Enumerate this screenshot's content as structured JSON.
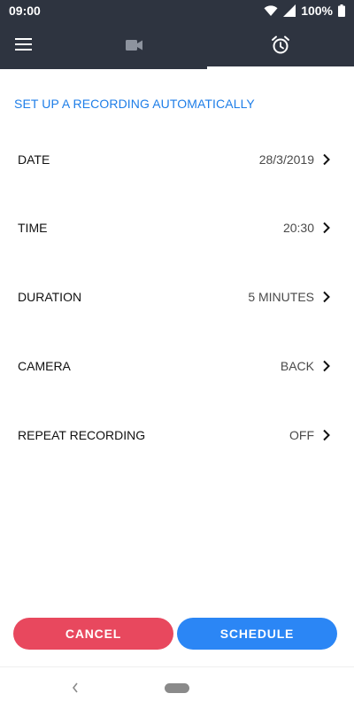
{
  "status_bar": {
    "time": "09:00",
    "battery": "100%"
  },
  "nav": {
    "tabs": [
      {
        "icon": "video-camera-icon",
        "active": false
      },
      {
        "icon": "alarm-clock-icon",
        "active": true
      }
    ]
  },
  "section_title": "SET UP A RECORDING AUTOMATICALLY",
  "settings": [
    {
      "label": "DATE",
      "value": "28/3/2019"
    },
    {
      "label": "TIME",
      "value": "20:30"
    },
    {
      "label": "DURATION",
      "value": "5 MINUTES"
    },
    {
      "label": "CAMERA",
      "value": "BACK"
    },
    {
      "label": "REPEAT RECORDING",
      "value": "OFF"
    }
  ],
  "actions": {
    "cancel_label": "CANCEL",
    "schedule_label": "SCHEDULE"
  },
  "colors": {
    "header_bg": "#2e3440",
    "accent_blue": "#1e7ee8",
    "cancel_red": "#e8485e",
    "schedule_blue": "#2b86f5"
  }
}
